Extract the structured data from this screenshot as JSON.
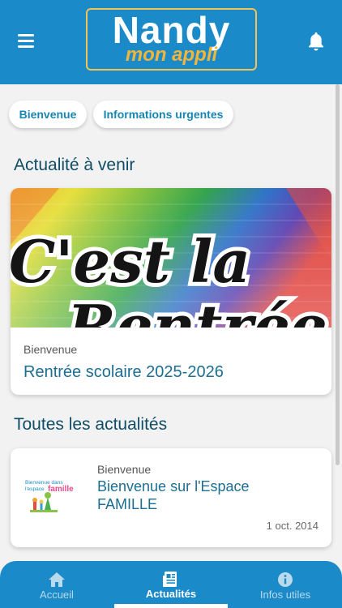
{
  "header": {
    "logo_title": "Nandy",
    "logo_subtitle": "mon appli",
    "menu_icon": "hamburger-icon",
    "bell_icon": "bell-icon"
  },
  "chips": [
    "Bienvenue",
    "Informations urgentes"
  ],
  "sections": {
    "upcoming": "Actualité à venir",
    "all": "Toutes les actualités"
  },
  "featured": {
    "image_text_line1": "C'est la",
    "image_text_line2": "Rentrée !",
    "category": "Bienvenue",
    "title": "Rentrée scolaire 2025-2026"
  },
  "news": [
    {
      "thumb_text_line1": "Bienvenue dans",
      "thumb_text_line2": "l'espace",
      "thumb_text_famille": "famille",
      "category": "Bienvenue",
      "title": "Bienvenue sur l'Espace FAMILLE",
      "date": "1 oct. 2014"
    }
  ],
  "tabs": [
    {
      "label": "Accueil",
      "icon": "home-icon",
      "active": false
    },
    {
      "label": "Actualités",
      "icon": "newspaper-icon",
      "active": true
    },
    {
      "label": "Infos utiles",
      "icon": "info-icon",
      "active": false
    }
  ],
  "colors": {
    "brand_blue": "#1a8ac9",
    "title_blue": "#1c6e93",
    "logo_gold": "#f2b53c"
  }
}
